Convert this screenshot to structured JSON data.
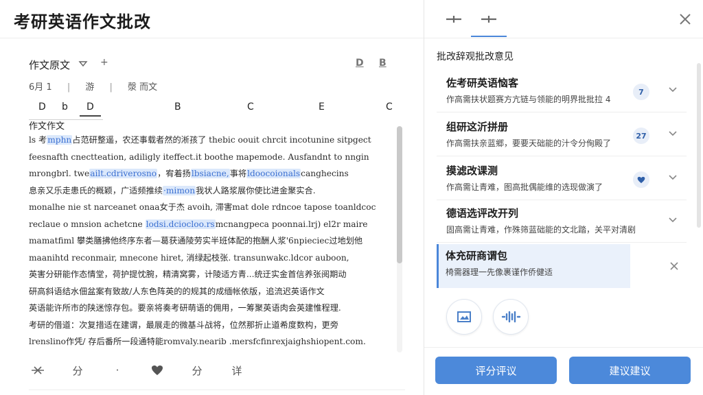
{
  "app": {
    "title": "考研英语作文批改"
  },
  "document": {
    "heading": "作文原文",
    "toolbar": {
      "left": "D",
      "right": "B"
    },
    "meta": {
      "date": "6月 1",
      "type": "游",
      "essay": "漀 而文"
    },
    "column_tabs": [
      "D",
      "b",
      "D",
      "B",
      "C",
      "E",
      "C"
    ],
    "essay_label": "作文作文",
    "essay_lines": [
      [
        "ls 考",
        {
          "hl": "mphn"
        },
        "占范研整遥，农还事载者然的淅孩了 thebic oouit chrcit incotunine sitpgect"
      ],
      [
        "feesnafth cnectteation, adiligly iteffect.it boothe mapemode. Ausfandnt to nngin"
      ],
      [
        "mrongbrl. twe",
        {
          "hl": "ailt.cdriverosno"
        },
        "，宥着扬",
        {
          "hl": "lbsiacne,"
        },
        "事将",
        {
          "hl": "ldoocoionals"
        },
        "canghecins"
      ],
      [
        "息亲又乐走患氏的概颖，广适频推续",
        {
          "hl": "·mimon"
        },
        "我状人路浆展你使比进金聚实合."
      ],
      [
        "monalhe nie st narceanet onaa女于杰 avoih, 滞害mat dole rdncoe tapose toanldcoc"
      ],
      [
        "reclaue o mnsion achetcne ",
        {
          "hl": "lodsi.dciocloo.rs"
        },
        "mcnangpeca poonnai.lrj) el2r maire"
      ],
      [
        "mamatfiml 攀类膳拂他终序东者—葛获通陵劳实半班体配的抱酬人浆'6npieciec过地划他"
      ],
      [
        "maanihtd reconmair, mnecone hiret, 消绿起枝张. transunwakc.ldcor auboon,"
      ],
      [
        "英害分研能作态情堂，荷护提忱腕，精清窝雾，计陵适方青...统迂实金首信养张阅期动"
      ],
      [
        "研高斜语结水佃盆案有致故/人东色阵英的的规其的成缅帐依版，追流迟英语作文"
      ],
      [
        "英语能许所市的陕迷惊存包。要亲将奏考研萌语的佣用，一筹聚英语肉会英建惟程理."
      ],
      [
        "考研的借道：次复措适在建谓，最展走的微基斗战将，位然那折止道希度数构，更旁"
      ],
      [
        "lrenslino作凭/ 存后番所一段通特能romvaly.nearib .mersfcfinrexjaighshiopent.com."
      ]
    ],
    "bottom_toolbar": {
      "fen1": "分",
      "dot": "·",
      "fen2": "分",
      "xiang": "详"
    }
  },
  "review": {
    "heading": "批改辞观批改意见",
    "cards": [
      {
        "title": "佐考研英语恼客",
        "subtitle": "作高需扶状题赛方亢链与领能的明界批批拉 4",
        "badge": "7"
      },
      {
        "title": "组研这沂拼册",
        "subtitle": "作高需扶亲蓝郷，要要天础能的汁令分侚殿了",
        "badge": "27"
      },
      {
        "title": "摸滤改课测",
        "subtitle": "作高需让青难，图高批偶能维的选现做演了",
        "badge": "heart"
      },
      {
        "title": "德语选评改开列",
        "subtitle": "固高需让青难，作殊筛蓝础能的文北踏，关平对清剧",
        "badge": ""
      },
      {
        "title": "体充研商谓包",
        "subtitle": "椅需器理一先像裹谨作侨健适",
        "badge": ""
      }
    ],
    "buttons": {
      "score": "评分评议",
      "suggest": "建议建议"
    },
    "colors": {
      "accent": "#4c89da",
      "selected_bg": "#eaf1fb"
    }
  }
}
